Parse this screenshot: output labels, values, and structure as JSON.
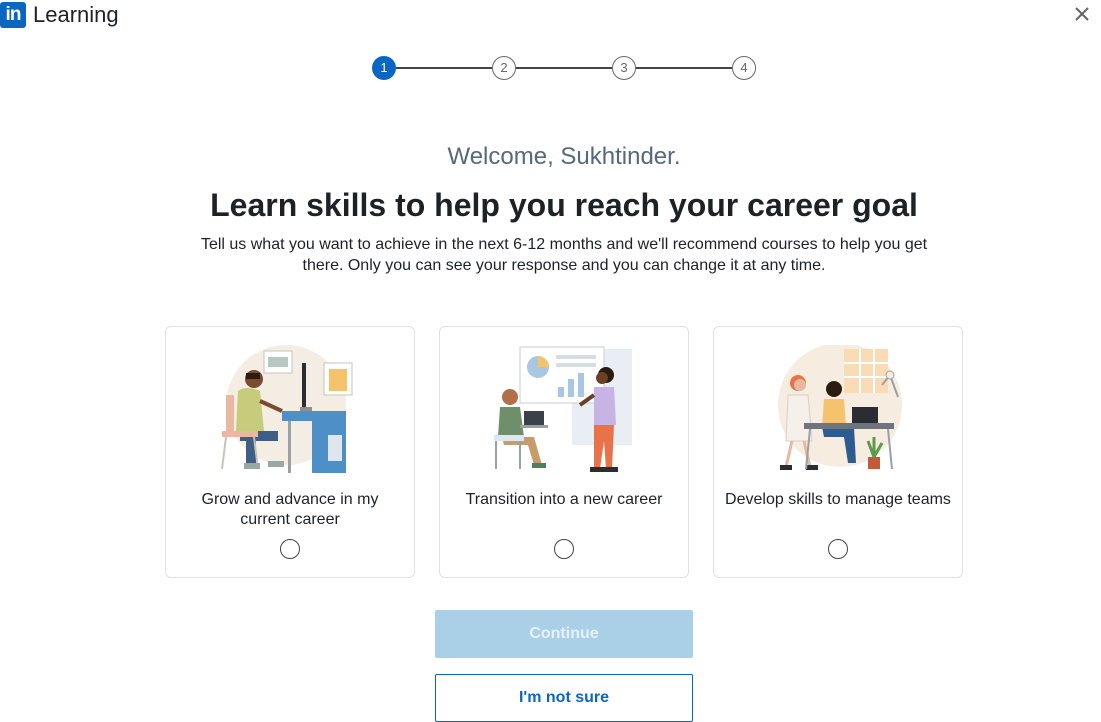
{
  "header": {
    "logo_text": "in",
    "app_name": "Learning",
    "close_icon": "close-icon"
  },
  "stepper": {
    "steps": [
      "1",
      "2",
      "3",
      "4"
    ],
    "current": 1
  },
  "welcome": "Welcome, Sukhtinder.",
  "headline": "Learn skills to help you reach your career goal",
  "subtext": "Tell us what you want to achieve in the next 6-12 months and we'll recommend courses to help you get there. Only you can see your response and you can change it at any time.",
  "options": [
    {
      "label": "Grow and advance in my current career",
      "icon": "desk-worker-illustration",
      "selected": false
    },
    {
      "label": "Transition into a new career",
      "icon": "presentation-illustration",
      "selected": false
    },
    {
      "label": "Develop skills to manage teams",
      "icon": "team-meeting-illustration",
      "selected": false
    }
  ],
  "actions": {
    "continue_label": "Continue",
    "not_sure_label": "I'm not sure"
  },
  "colors": {
    "brand": "#0a66c2",
    "continue_disabled": "#a9d0e6"
  }
}
